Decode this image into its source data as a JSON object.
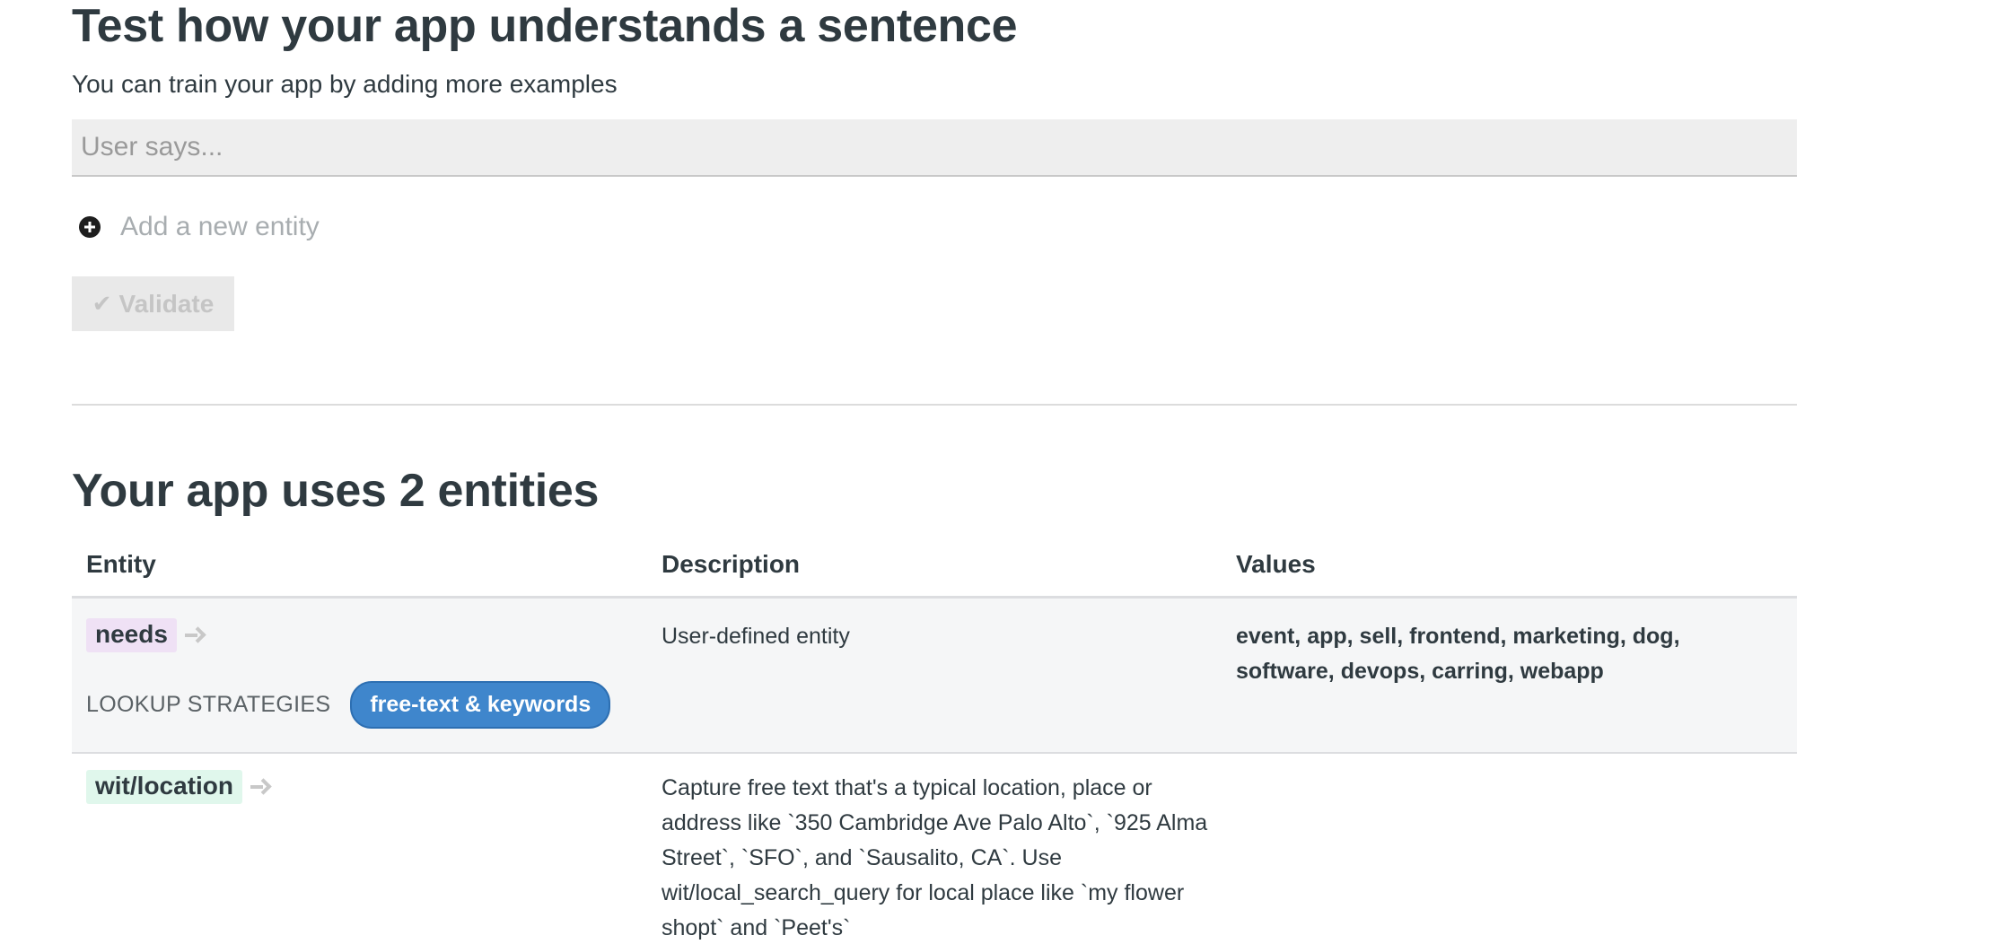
{
  "test_section": {
    "title": "Test how your app understands a sentence",
    "subtitle": "You can train your app by adding more examples",
    "input_placeholder": "User says...",
    "add_entity_label": "Add a new entity",
    "validate_label": "Validate"
  },
  "entities_section": {
    "title": "Your app uses 2 entities",
    "columns": {
      "entity": "Entity",
      "description": "Description",
      "values": "Values"
    },
    "rows": [
      {
        "entity": "needs",
        "lookup_label": "LOOKUP STRATEGIES",
        "strategy": "free-text & keywords",
        "description": "User-defined entity",
        "values": "event, app, sell, frontend, marketing, dog, software, devops, carring, webapp"
      },
      {
        "entity": "wit/location",
        "description": "Capture free text that's a typical location, place or address like `350 Cambridge Ave Palo Alto`, `925 Alma Street`, `SFO`, and `Sausalito, CA`. Use wit/local_search_query for local place like `my flower shopt` and `Peet's`",
        "values": ""
      }
    ]
  },
  "colors": {
    "text": "#2f3a40",
    "input_bg": "#eeeeee",
    "row_bg": "#f5f6f7",
    "badge_blue": "#3f86cc",
    "needs_tag": "#efe1f5",
    "location_tag": "#e0f7ec"
  }
}
